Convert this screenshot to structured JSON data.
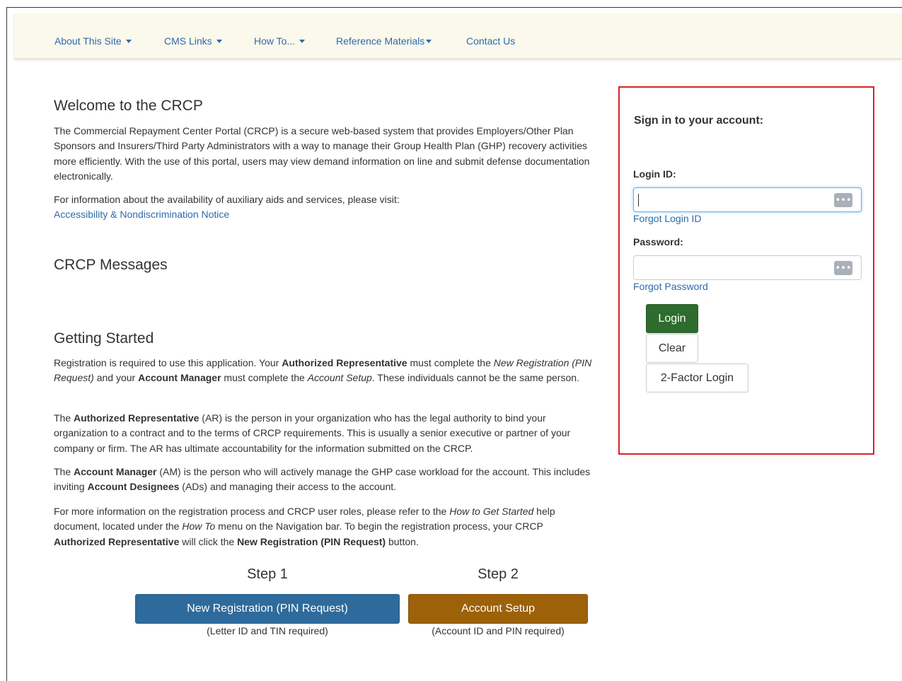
{
  "nav": {
    "items": [
      {
        "label": "About This Site",
        "has_caret": true
      },
      {
        "label": "CMS Links",
        "has_caret": true
      },
      {
        "label": "How To...",
        "has_caret": true
      },
      {
        "label": "Reference Materials",
        "has_caret": true
      },
      {
        "label": "Contact Us",
        "has_caret": false
      }
    ]
  },
  "welcome": {
    "title": "Welcome to the CRCP",
    "paragraph": "The Commercial Repayment Center Portal (CRCP) is a secure web-based system that provides Employers/Other Plan Sponsors and Insurers/Third Party Administrators with a way to manage their Group Health Plan (GHP) recovery activities more efficiently. With the use of this portal, users may view demand information on line and submit defense documentation electronically.",
    "aux_text": "For information about the availability of auxiliary aids and services, please visit:",
    "aux_link": "Accessibility & Nondiscrimination Notice"
  },
  "messages": {
    "title": "CRCP Messages"
  },
  "getting_started": {
    "title": "Getting Started",
    "p1": {
      "t1": "Registration is required to use this application. Your ",
      "b1": "Authorized Representative",
      "t2": " must complete the ",
      "i1": "New Registration (PIN Request)",
      "t3": " and your ",
      "b2": "Account Manager",
      "t4": " must complete the ",
      "i2": "Account Setup",
      "t5": ". These individuals cannot be the same person."
    },
    "p2": {
      "t1": "The ",
      "b1": "Authorized Representative",
      "t2": " (AR) is the person in your organization who has the legal authority to bind your organization to a contract and to the terms of CRCP requirements. This is usually a senior executive or partner of your company or firm. The AR has ultimate accountability for the information submitted on the CRCP."
    },
    "p3": {
      "t1": "The ",
      "b1": "Account Manager",
      "t2": " (AM) is the person who will actively manage the GHP case workload for the account. This includes inviting ",
      "b2": "Account Designees",
      "t3": " (ADs) and managing their access to the account."
    },
    "p4": {
      "t1": "For more information on the registration process and CRCP user roles, please refer to the ",
      "i1": "How to Get Started",
      "t2": " help document, located under the ",
      "i2": "How To",
      "t3": " menu on the Navigation bar. To begin the registration process, your CRCP ",
      "b1": "Authorized Representative",
      "t4": " will click the ",
      "b2": "New Registration (PIN Request)",
      "t5": " button."
    }
  },
  "steps": [
    {
      "label": "Step 1",
      "button": "New Registration (PIN Request)",
      "note": "(Letter ID and TIN required)",
      "color": "#2e6b9c"
    },
    {
      "label": "Step 2",
      "button": "Account Setup",
      "note": "(Account ID and PIN required)",
      "color": "#9c6109"
    }
  ],
  "login": {
    "title": "Sign in to your account:",
    "login_id_label": "Login ID:",
    "login_id_value": "",
    "forgot_login": "Forgot Login ID",
    "password_label": "Password:",
    "password_value": "",
    "forgot_password": "Forgot Password",
    "login_button": "Login",
    "clear_button": "Clear",
    "two_factor_button": "2-Factor Login",
    "field_icon": "password-manager-icon",
    "highlight_color": "#d9212b"
  }
}
